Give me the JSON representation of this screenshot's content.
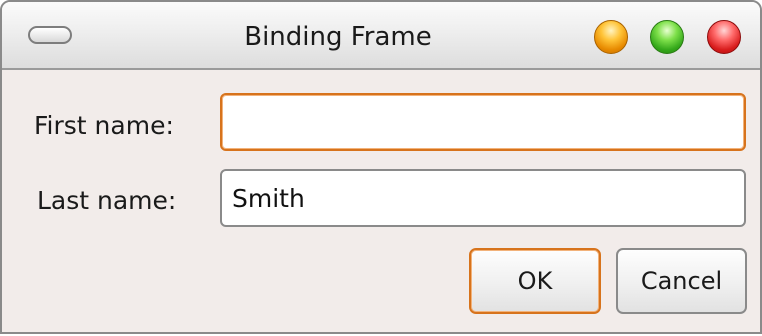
{
  "window": {
    "title": "Binding Frame"
  },
  "form": {
    "first_name": {
      "label": "First name:",
      "value": ""
    },
    "last_name": {
      "label": "Last name:",
      "value": "Smith"
    }
  },
  "buttons": {
    "ok_label": "OK",
    "cancel_label": "Cancel"
  },
  "icons": {
    "window_menu": "pill-button-icon",
    "minimize": "minimize-icon",
    "maximize": "maximize-icon",
    "close": "close-icon"
  },
  "colors": {
    "focus_accent": "#d7731c",
    "window_background": "#f2ecea",
    "minimize": "#ffc438",
    "maximize": "#34a81a",
    "close": "#d81c1c"
  }
}
